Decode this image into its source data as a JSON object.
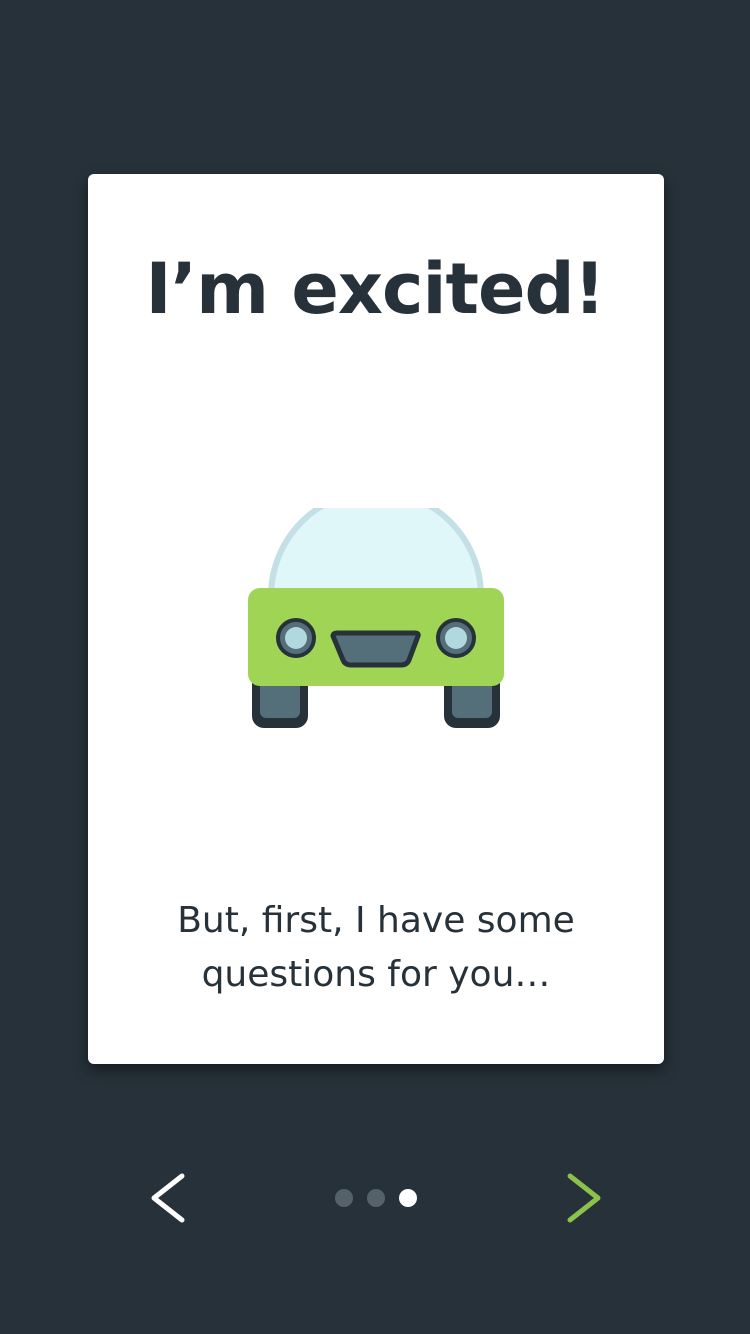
{
  "card": {
    "title": "I’m excited!",
    "message": "But, first, I have some questions for you…"
  },
  "illustration": {
    "icon": "smiling-car-icon",
    "colors": {
      "body": "#a0d455",
      "windshield": "#e0f7fa",
      "windshield_outline": "#c5dfe6",
      "headlight": "#b2d8df",
      "dark": "#263139",
      "wheel": "#546e7a"
    }
  },
  "navigation": {
    "prev_icon": "chevron-left-icon",
    "next_icon": "chevron-right-icon",
    "prev_color": "#ffffff",
    "next_color": "#8bc34a",
    "page_count": 3,
    "current_page": 3
  },
  "theme": {
    "background": "#263139",
    "card": "#ffffff",
    "text": "#263139"
  }
}
